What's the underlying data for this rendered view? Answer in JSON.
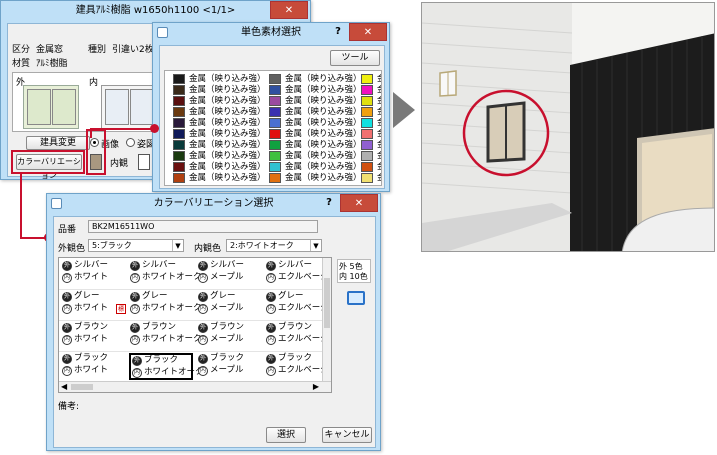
{
  "window1": {
    "title": "建具ｱﾙﾐ樹脂 w1650h1100 <1/1>",
    "close": "✕",
    "kubun_label": "区分",
    "kubun_value": "金属窓",
    "shubetsu_label": "種別",
    "shubetsu_value": "引違い2枚",
    "zaishitsu_label": "材質",
    "zaishitsu_value": "ｱﾙﾐ樹脂",
    "outer_label": "外",
    "inner_label": "内",
    "change_button": "建具変更",
    "variation_button": "カラーバリエーション",
    "radio_image": "画像",
    "radio_color": "姿図",
    "inner_view_label": "内観"
  },
  "window2": {
    "title": "単色素材選択",
    "help": "?",
    "close": "✕",
    "tool_button": "ツール",
    "materials": [
      {
        "label": "金属（映り込み強）",
        "color": "#1a1a1a"
      },
      {
        "label": "金属（映り込み強）",
        "color": "#3a2a1a"
      },
      {
        "label": "金属（映り込み強）",
        "color": "#5a1010"
      },
      {
        "label": "金属（映り込み強）",
        "color": "#6a3a10"
      },
      {
        "label": "金属（映り込み強）",
        "color": "#2a1a3a"
      },
      {
        "label": "金属（映り込み強）",
        "color": "#101a5a"
      },
      {
        "label": "金属（映り込み強）",
        "color": "#0a3a3a"
      },
      {
        "label": "金属（映り込み強）",
        "color": "#1a3a10"
      },
      {
        "label": "金属（映り込み強）",
        "color": "#6a1010"
      },
      {
        "label": "金属（映り込み強）",
        "color": "#b04010"
      }
    ],
    "materials_col2": [
      {
        "label": "金属（映り込み強）",
        "color": "#606060"
      },
      {
        "label": "金属（映り込み強）",
        "color": "#3050a0"
      },
      {
        "label": "金属（映り込み強）",
        "color": "#9a4aa0"
      },
      {
        "label": "金属（映り込み強）",
        "color": "#3a30b0"
      },
      {
        "label": "金属（映り込み強）",
        "color": "#4a70d0"
      },
      {
        "label": "金属（映り込み強）",
        "color": "#e01010"
      },
      {
        "label": "金属（映り込み強）",
        "color": "#10a040"
      },
      {
        "label": "金属（映り込み強）",
        "color": "#40c040"
      },
      {
        "label": "金属（映り込み強）",
        "color": "#30c0d0"
      },
      {
        "label": "金属（映り込み強）",
        "color": "#e07010"
      }
    ],
    "materials_col3": [
      {
        "label": "金",
        "color": "#f0f010"
      },
      {
        "label": "金",
        "color": "#f010c0"
      },
      {
        "label": "金",
        "color": "#e0e010"
      },
      {
        "label": "金",
        "color": "#f0a010"
      },
      {
        "label": "金",
        "color": "#10e0e0"
      },
      {
        "label": "金",
        "color": "#f07070"
      },
      {
        "label": "金",
        "color": "#9060d0"
      },
      {
        "label": "金",
        "color": "#b0b0b0"
      },
      {
        "label": "金",
        "color": "#d05010"
      },
      {
        "label": "金",
        "color": "#f0e070"
      }
    ]
  },
  "window3": {
    "title": "カラーバリエーション選択",
    "help": "?",
    "close": "✕",
    "hinban_label": "品番",
    "hinban_value": "BK2M16511WO",
    "outer_color_label": "外観色",
    "outer_color_value": "5:ブラック",
    "inner_color_label": "内観色",
    "inner_color_value": "2:ホワイトオーク",
    "side_outer": "外 5色",
    "side_inner": "内 10色",
    "remarks_label": "備考:",
    "select_button": "選択",
    "cancel_button": "キャンセル",
    "grid": [
      [
        [
          "シルバー",
          "ホワイト"
        ],
        [
          "シルバー",
          "ホワイトオーク"
        ],
        [
          "シルバー",
          "メープル"
        ],
        [
          "シルバー",
          "エクルベージュ"
        ]
      ],
      [
        [
          "グレー",
          "ホワイト"
        ],
        [
          "グレー",
          "ホワイトオーク"
        ],
        [
          "グレー",
          "メープル"
        ],
        [
          "グレー",
          "エクルベージュ"
        ]
      ],
      [
        [
          "ブラウン",
          "ホワイト"
        ],
        [
          "ブラウン",
          "ホワイトオーク"
        ],
        [
          "ブラウン",
          "メープル"
        ],
        [
          "ブラウン",
          "エクルベージュ"
        ]
      ],
      [
        [
          "ブラック",
          "ホワイト"
        ],
        [
          "ブラック",
          "ホワイトオーク"
        ],
        [
          "ブラック",
          "メープル"
        ],
        [
          "ブラック",
          "エクルベージュ"
        ]
      ]
    ],
    "mark_outer": "外",
    "mark_inner": "内",
    "mark_ban": "標"
  },
  "arrow_colors": {
    "accent": "#c8102e"
  }
}
